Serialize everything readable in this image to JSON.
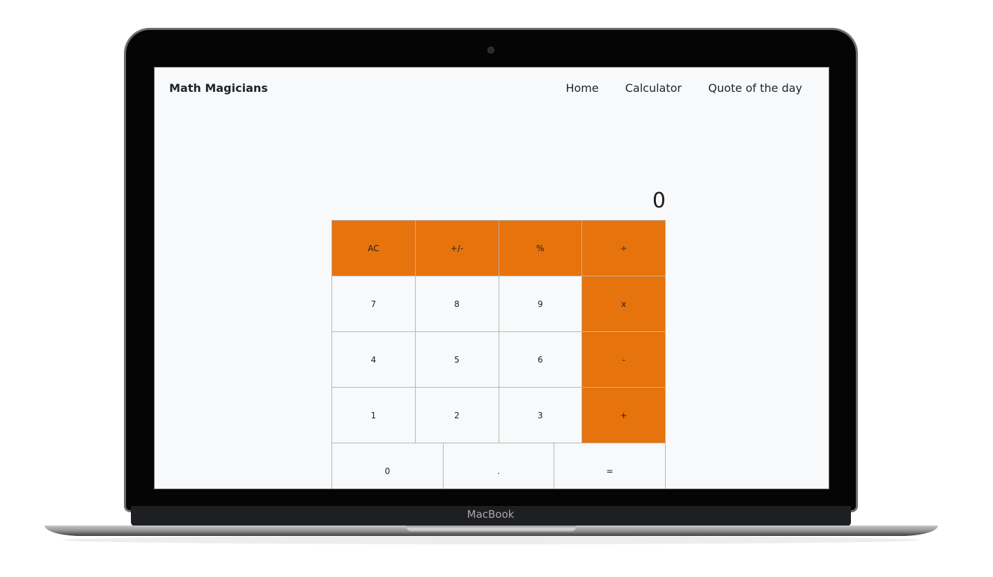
{
  "device": {
    "brand_label": "MacBook"
  },
  "app": {
    "logo": "Math Magicians",
    "nav": [
      "Home",
      "Calculator",
      "Quote of the day"
    ]
  },
  "calculator": {
    "display": "0",
    "rows": [
      [
        "AC",
        "+/-",
        "%",
        "÷"
      ],
      [
        "7",
        "8",
        "9",
        "x"
      ],
      [
        "4",
        "5",
        "6",
        "-"
      ],
      [
        "1",
        "2",
        "3",
        "+"
      ],
      [
        "0",
        ".",
        "="
      ]
    ]
  },
  "colors": {
    "accent": "#e7730c",
    "screen_bg": "#f8f9fa"
  }
}
